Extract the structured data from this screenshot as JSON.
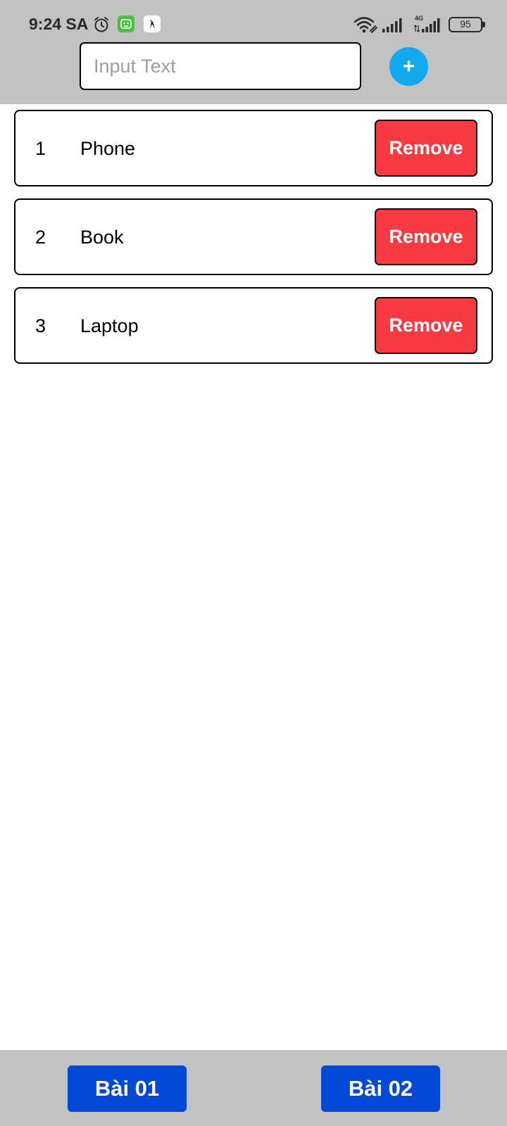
{
  "status_bar": {
    "time": "9:24 SA",
    "network": "4G",
    "battery": "95"
  },
  "input": {
    "placeholder": "Input Text",
    "value": ""
  },
  "add_button": {
    "label": "+"
  },
  "items": [
    {
      "index": "1",
      "name": "Phone",
      "remove_label": "Remove"
    },
    {
      "index": "2",
      "name": "Book",
      "remove_label": "Remove"
    },
    {
      "index": "3",
      "name": "Laptop",
      "remove_label": "Remove"
    }
  ],
  "bottom_nav": [
    {
      "label": "Bài 01"
    },
    {
      "label": "Bài 02"
    }
  ],
  "colors": {
    "header_bg": "#c2c2c2",
    "add_button": "#12a9f0",
    "remove_button": "#f83b42",
    "nav_button": "#0449d6"
  },
  "icons": [
    "alarm-icon",
    "app-green-icon",
    "app-white-icon",
    "wifi-icon",
    "cell-signal-icon",
    "battery-icon"
  ]
}
